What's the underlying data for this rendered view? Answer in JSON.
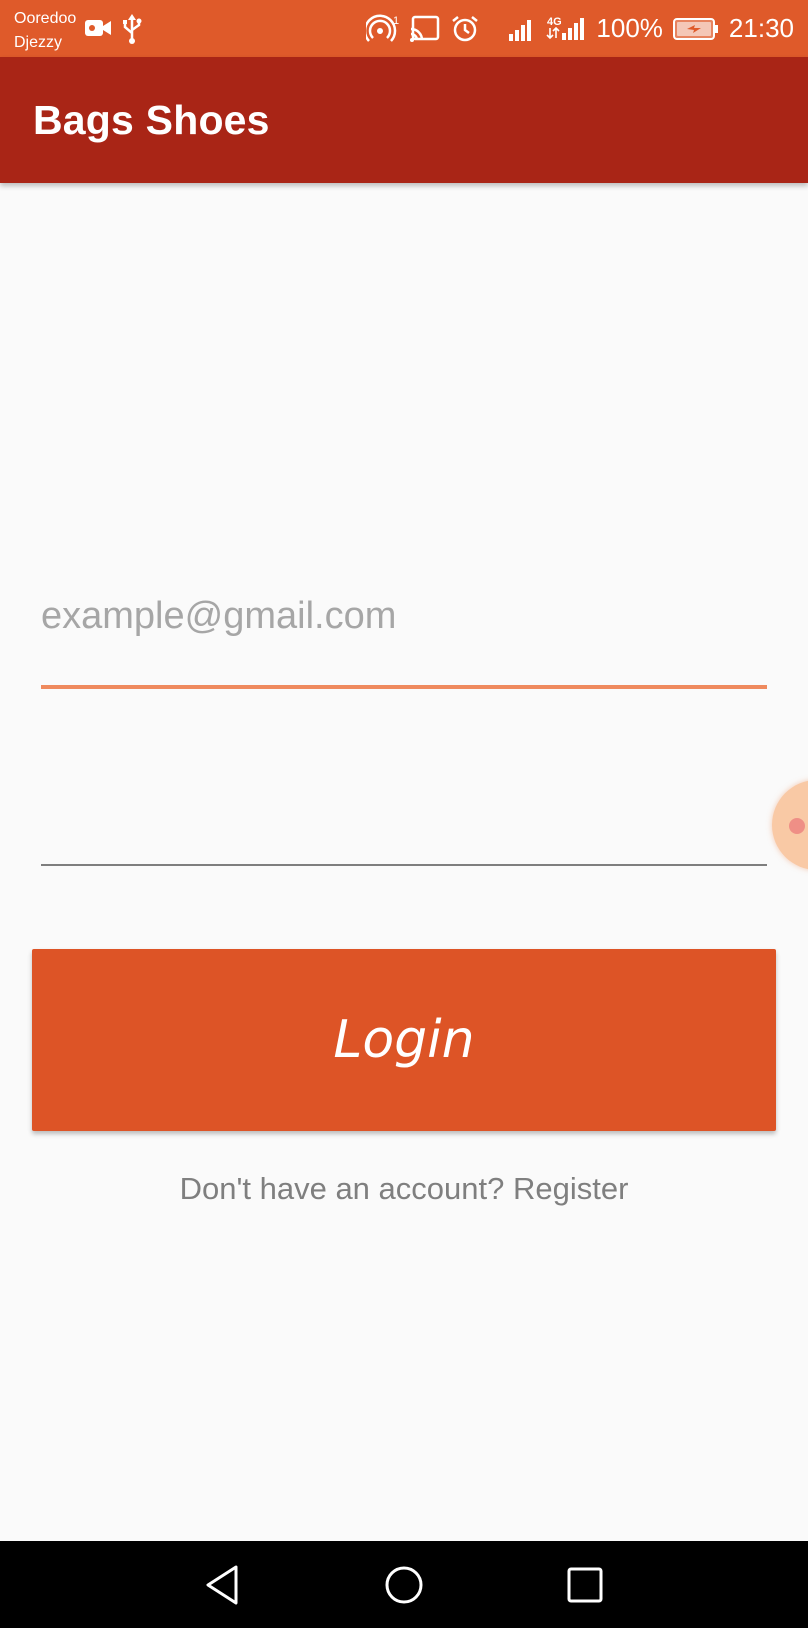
{
  "status_bar": {
    "carrier_1": "Ooredoo",
    "carrier_2": "Djezzy",
    "network_type": "4G",
    "battery": "100%",
    "time": "21:30",
    "icons": [
      "video-camera-icon",
      "usb-icon",
      "hotspot-icon",
      "cast-icon",
      "alarm-icon",
      "signal-icon",
      "signal-4g-icon",
      "battery-charging-icon"
    ]
  },
  "app_bar": {
    "title": "Bags Shoes"
  },
  "login_form": {
    "email_placeholder": "example@gmail.com",
    "email_value": "",
    "password_value": "",
    "login_label": "Login",
    "register_text": "Don't have an account? Register"
  },
  "nav_bar": {
    "icons": [
      "back-icon",
      "home-icon",
      "recents-icon"
    ]
  },
  "colors": {
    "status_bar": "#df5a2a",
    "app_bar": "#a92516",
    "button": "#dd5426",
    "focused_underline": "#ef8a5e"
  }
}
